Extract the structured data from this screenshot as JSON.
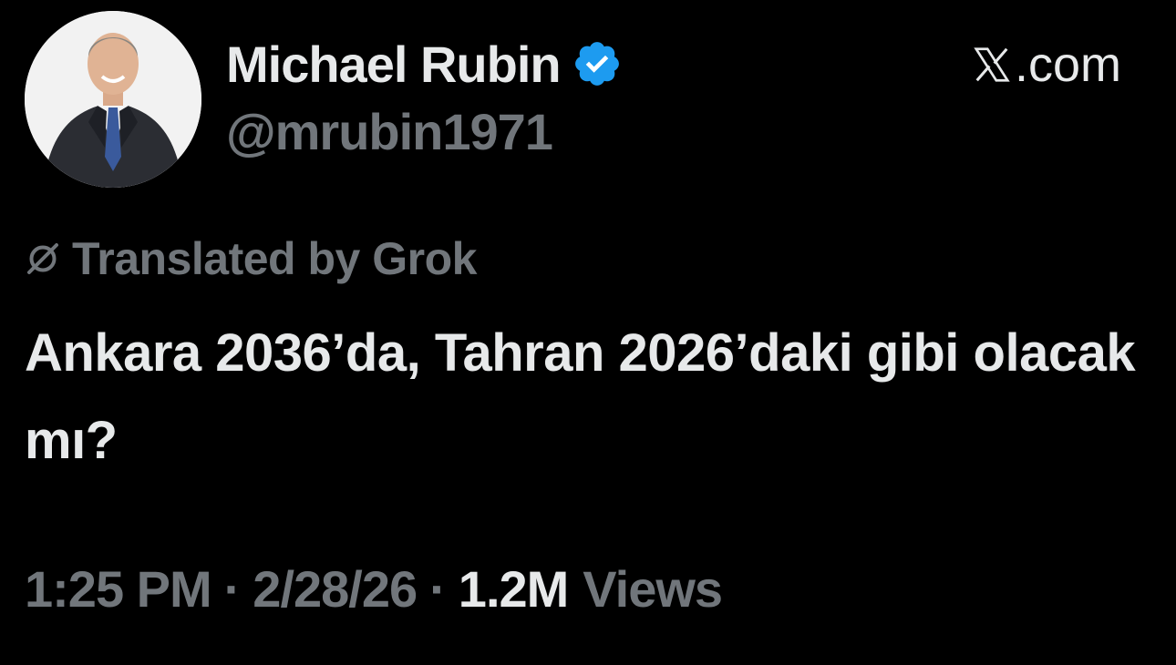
{
  "author": {
    "display_name": "Michael Rubin",
    "handle": "@mrubin1971",
    "verified": true,
    "avatar": "profile-photo"
  },
  "brand": {
    "logo": "x-logo-icon",
    "label": ".com"
  },
  "translation": {
    "icon": "grok-icon",
    "label": "Translated by Grok"
  },
  "tweet": {
    "text": "Ankara 2036’da, Tahran 2026’daki gibi olacak mı?"
  },
  "meta": {
    "time": "1:25 PM",
    "date": "2/28/26",
    "views_count": "1.2M",
    "views_label": "Views",
    "separator": "·"
  },
  "colors": {
    "background": "#000000",
    "primary_text": "#e7e9ea",
    "secondary_text": "#71767b",
    "verified_blue": "#1d9bf0"
  }
}
